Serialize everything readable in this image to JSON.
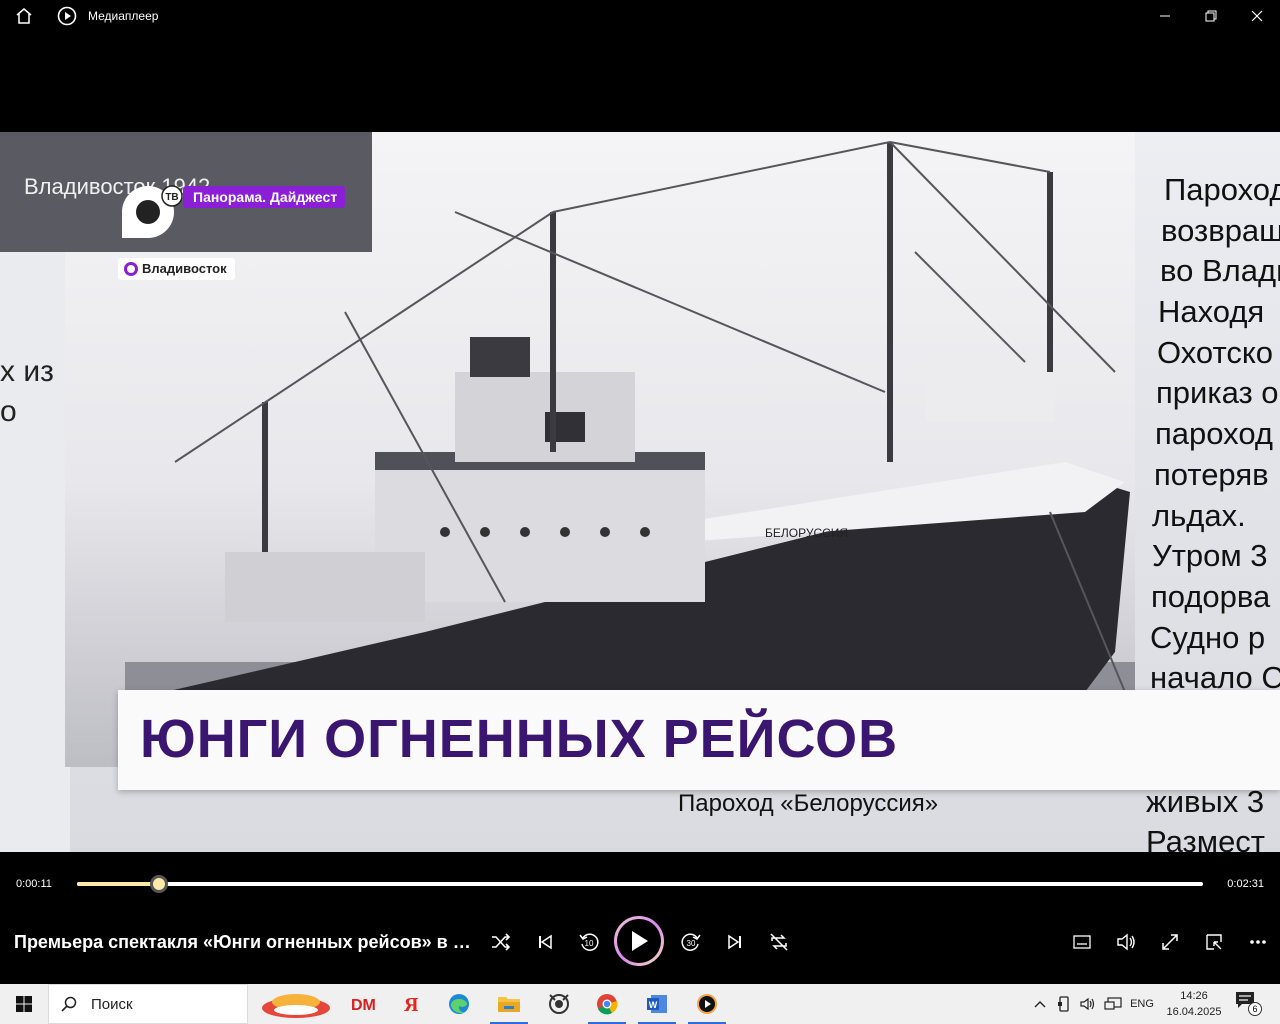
{
  "window": {
    "title": "Медиаплеер"
  },
  "video": {
    "channel_badge": "Панорама. Дайджест",
    "logo_sub": "ТВ",
    "location": "Владивосток",
    "inset_text": "Владивосток 1942",
    "left_text_lines": [
      "х из",
      "о"
    ],
    "right_text_lines": [
      "Пароход",
      "возвраща",
      "во Влади",
      "Находя",
      "Охотско",
      "приказ о",
      "пароход",
      "потеряв",
      "льдах.",
      "Утром 3",
      "подорва",
      "Судно р",
      "начало С"
    ],
    "right_text_bottom": [
      "живых 3",
      "Размест"
    ],
    "photo_caption": "Пароход «Белоруссия»",
    "ship_name": "БЕЛОРУССИЯ",
    "lower_third": "ЮНГИ ОГНЕННЫХ РЕЙСОВ"
  },
  "player": {
    "current_time": "0:00:11",
    "duration": "0:02:31",
    "progress_fraction": 0.073,
    "media_title": "Премьера спектакля «Юнги огненных рейсов» в Приморском...",
    "colors": {
      "seek_fill": "#fbe9a8",
      "badge": "#8b1fd6",
      "title_text": "#3a1670"
    },
    "buttons": [
      "shuffle",
      "previous",
      "skip-back-10",
      "play",
      "skip-forward-30",
      "next",
      "repeat-off",
      "subtitles",
      "volume",
      "fullscreen",
      "mini-player",
      "more"
    ]
  },
  "taskbar": {
    "search_placeholder": "Поиск",
    "apps": [
      "weather-widget",
      "dm-app",
      "yandex-browser",
      "edge",
      "file-explorer",
      "screenshot-tool",
      "chrome",
      "word",
      "media-player"
    ],
    "language": "ENG",
    "time": "14:26",
    "date": "16.04.2025",
    "notification_count": "6"
  }
}
